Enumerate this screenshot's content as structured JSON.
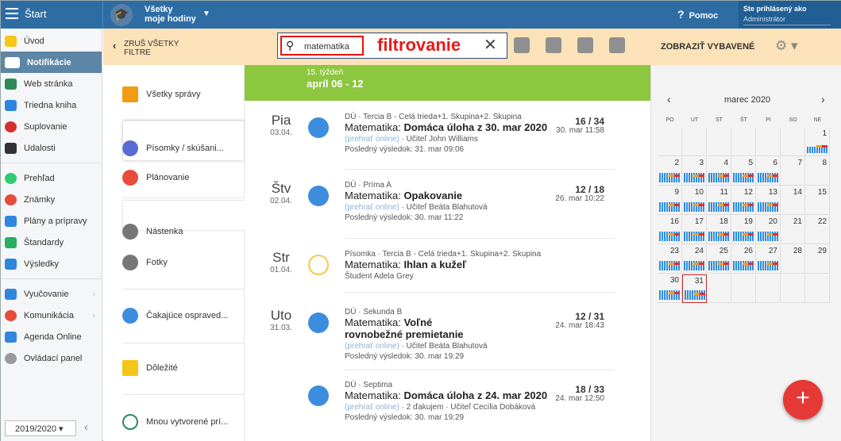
{
  "header": {
    "home_label": "Štart",
    "workspace_line1": "Všetky",
    "workspace_line2": "moje hodiny",
    "help_label": "Pomoc",
    "login_label": "Ste prihlásený ako",
    "login_role": "Administrátor"
  },
  "sidebar": {
    "items": [
      {
        "label": "Úvod",
        "color": "#f5c518"
      },
      {
        "label": "Notifikácie",
        "color": "#ffffff"
      },
      {
        "label": "Web stránka",
        "color": "#2e8b57"
      },
      {
        "label": "Triedna kniha",
        "color": "#2e86de"
      },
      {
        "label": "Suplovanie",
        "color": "#d32f2f"
      },
      {
        "label": "Udalosti",
        "color": "#333333"
      },
      {
        "label": "Prehľad",
        "color": "#2ecc71"
      },
      {
        "label": "Známky",
        "color": "#e74c3c"
      },
      {
        "label": "Plány a prípravy",
        "color": "#2e86de"
      },
      {
        "label": "Štandardy",
        "color": "#27ae60"
      },
      {
        "label": "Výsledky",
        "color": "#2e86de"
      },
      {
        "label": "Vyučovanie",
        "color": "#2e86de"
      },
      {
        "label": "Komunikácia",
        "color": "#e74c3c"
      },
      {
        "label": "Agenda Online",
        "color": "#2e86de"
      },
      {
        "label": "Ovládací panel",
        "color": "#999999"
      }
    ],
    "school_year": "2019/2020"
  },
  "filterbar": {
    "back_line1": "ZRUŠ VŠETKY",
    "back_line2": "FILTRE",
    "search_value": "matematika",
    "search_annotation": "filtrovanie",
    "show_equipped": "ZOBRAZIŤ VYBAVENÉ"
  },
  "categories": [
    {
      "label": "Všetky správy",
      "color": "#f39c12"
    },
    {
      "label": "Písomky / skúšani...",
      "color": "#5b6bd6"
    },
    {
      "label": "Plánovanie",
      "color": "#e74c3c"
    },
    {
      "label": "Nástenka",
      "color": "#777777"
    },
    {
      "label": "Fotky",
      "color": "#777777"
    },
    {
      "label": "Čakajúce ospraved...",
      "color": "#3d8dde"
    },
    {
      "label": "Dôležité",
      "color": "#f5c518"
    },
    {
      "label": "Mnou vytvorené prí...",
      "color": "#2e8b57"
    }
  ],
  "week": {
    "label": "15. týždeň",
    "range": "apríl 06 - 12"
  },
  "entries": [
    {
      "day": "Pia",
      "date": "03.04.",
      "meta": "DÚ · Tercia B - Celá trieda+1. Skupina+2. Skupina",
      "subject": "Matematika:",
      "title": "Domáca úloha z 30. mar 2020",
      "online": "(prehrať online)",
      "teacher": "· Učiteľ John Williams",
      "result": "Posledný výsledok: 31. mar 09:06",
      "count": "16 / 34",
      "when": "30. mar 11:58"
    },
    {
      "day": "Štv",
      "date": "02.04.",
      "meta": "DÚ · Príma A",
      "subject": "Matematika:",
      "title": "Opakovanie",
      "online": "(prehrať online)",
      "teacher": "· Učiteľ Beáta Blahutová",
      "result": "Posledný výsledok: 30. mar 11:22",
      "count": "12 / 18",
      "when": "26. mar 10:22"
    },
    {
      "day": "Str",
      "date": "01.04.",
      "meta": "Písomka · Tercia B - Celá trieda+1. Skupina+2. Skupina",
      "subject": "Matematika:",
      "title": "Ihlan a kužeľ",
      "online": "",
      "teacher": "Študent Adela Grey",
      "result": "",
      "count": "",
      "when": ""
    },
    {
      "day": "Uto",
      "date": "31.03.",
      "meta": "DÚ · Sekunda B",
      "subject": "Matematika:",
      "title": "Voľné rovnobežné premietanie",
      "online": "(prehrať online)",
      "teacher": "· Učiteľ Beáta Blahutová",
      "result": "Posledný výsledok: 30. mar 19:29",
      "count": "12 / 31",
      "when": "24. mar 18:43"
    },
    {
      "day": "",
      "date": "",
      "meta": "DÚ · Septima",
      "subject": "Matematika:",
      "title": "Domáca úloha z 24. mar 2020",
      "online": "(prehrať online)",
      "teacher": "· 2 ďakujem · Učiteľ Cecília Dobáková",
      "result": "Posledný výsledok: 30. mar 19:29",
      "count": "18 / 33",
      "when": "24. mar 12:50"
    }
  ],
  "calendar": {
    "month": "marec 2020",
    "prev": "‹",
    "next": "›",
    "days_of_week": [
      "PO",
      "UT",
      "ST",
      "ŠT",
      "PI",
      "SO",
      "NE"
    ],
    "days": [
      "1",
      "2",
      "3",
      "4",
      "5",
      "6",
      "7",
      "8",
      "9",
      "10",
      "11",
      "12",
      "13",
      "14",
      "15",
      "16",
      "17",
      "18",
      "19",
      "20",
      "21",
      "22",
      "23",
      "24",
      "25",
      "26",
      "27",
      "28",
      "29",
      "30",
      "31"
    ]
  },
  "fab": "+"
}
